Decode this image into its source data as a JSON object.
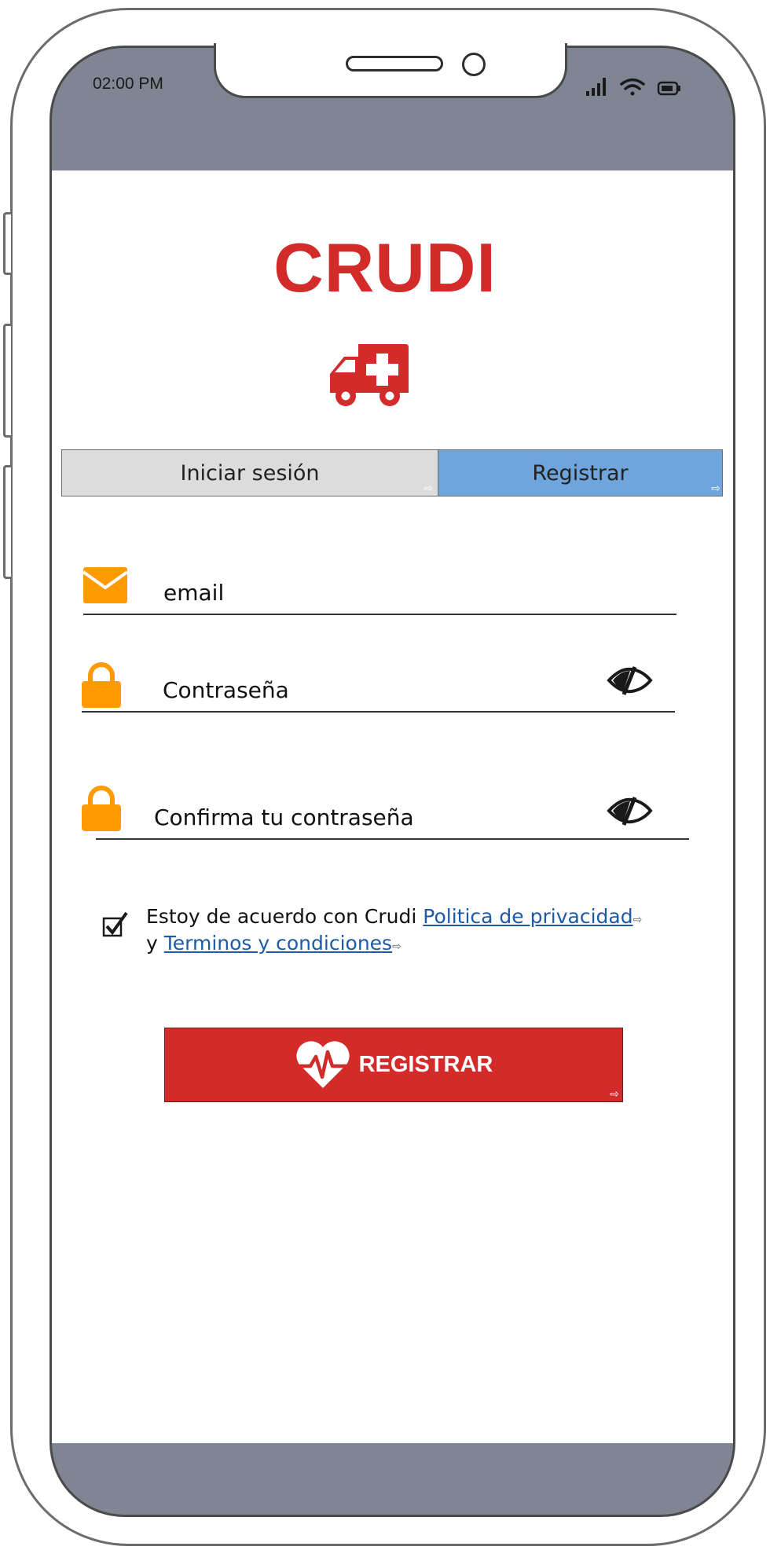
{
  "status_bar": {
    "time": "02:00 PM"
  },
  "app": {
    "title": "CRUDI"
  },
  "tabs": [
    {
      "label": "Iniciar sesión",
      "active": false
    },
    {
      "label": "Registrar",
      "active": true
    }
  ],
  "form": {
    "email": {
      "placeholder": "email",
      "icon": "envelope-icon"
    },
    "password": {
      "placeholder": "Contraseña",
      "icon": "lock-icon",
      "toggle_icon": "eye-off-icon"
    },
    "confirm_password": {
      "placeholder": "Confirma tu contraseña",
      "icon": "lock-icon",
      "toggle_icon": "eye-off-icon"
    }
  },
  "agreement": {
    "checked": true,
    "text_prefix": "Estoy de acuerdo con Crudi ",
    "privacy_link": "Politica de privacidad",
    "text_middle": "y ",
    "terms_link": "Terminos y condiciones"
  },
  "register_button": {
    "label": "REGISTRAR",
    "icon": "heart-pulse-icon"
  },
  "colors": {
    "brand_red": "#d32a2a",
    "icon_orange": "#ff9a00",
    "tab_active": "#6ea5dc",
    "tab_inactive": "#dcdcdc",
    "phone_frame": "#7f8593",
    "link_blue": "#1f5aa8"
  }
}
